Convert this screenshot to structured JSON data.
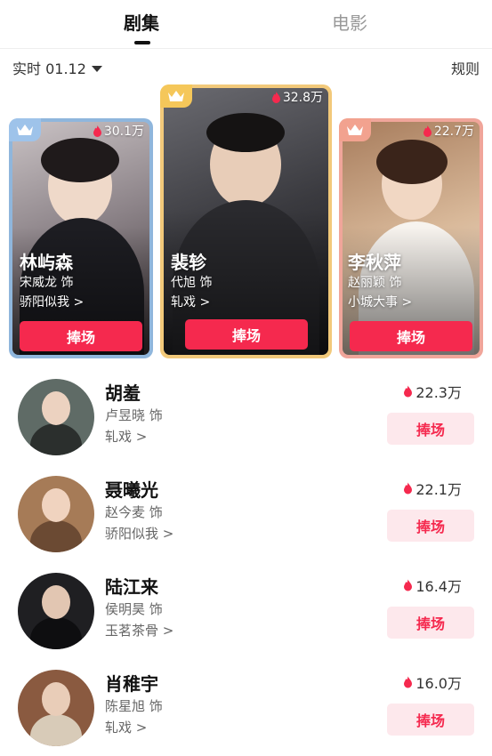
{
  "tabs": [
    {
      "label": "剧集",
      "active": true
    },
    {
      "label": "电影",
      "active": false
    }
  ],
  "filter": {
    "label": "实时 01.12",
    "icon": "caret-down-icon"
  },
  "rules_label": "规则",
  "podium": [
    {
      "rank": 2,
      "name": "林屿森",
      "actor": "宋威龙 饰",
      "show": "骄阳似我 >",
      "heat": "30.1万",
      "button": "捧场",
      "frame_color": "#8fb6dc",
      "badge_color": "#9ec3ea"
    },
    {
      "rank": 1,
      "name": "裴轸",
      "actor": "代旭 饰",
      "show": "轧戏 >",
      "heat": "32.8万",
      "button": "捧场",
      "frame_color": "#f2c97a",
      "badge_color": "#f5c75a"
    },
    {
      "rank": 3,
      "name": "李秋萍",
      "actor": "赵丽颖 饰",
      "show": "小城大事 >",
      "heat": "22.7万",
      "button": "捧场",
      "frame_color": "#f0a59a",
      "badge_color": "#f2a28f"
    }
  ],
  "list": [
    {
      "name": "胡羞",
      "actor": "卢昱晓 饰",
      "show": "轧戏 >",
      "heat": "22.3万",
      "button": "捧场"
    },
    {
      "name": "聂曦光",
      "actor": "赵今麦 饰",
      "show": "骄阳似我 >",
      "heat": "22.1万",
      "button": "捧场"
    },
    {
      "name": "陆江来",
      "actor": "侯明昊 饰",
      "show": "玉茗茶骨 >",
      "heat": "16.4万",
      "button": "捧场"
    },
    {
      "name": "肖稚宇",
      "actor": "陈星旭 饰",
      "show": "轧戏 >",
      "heat": "16.0万",
      "button": "捧场"
    }
  ],
  "colors": {
    "accent": "#f5294e",
    "accent_light": "#fde8ec"
  }
}
